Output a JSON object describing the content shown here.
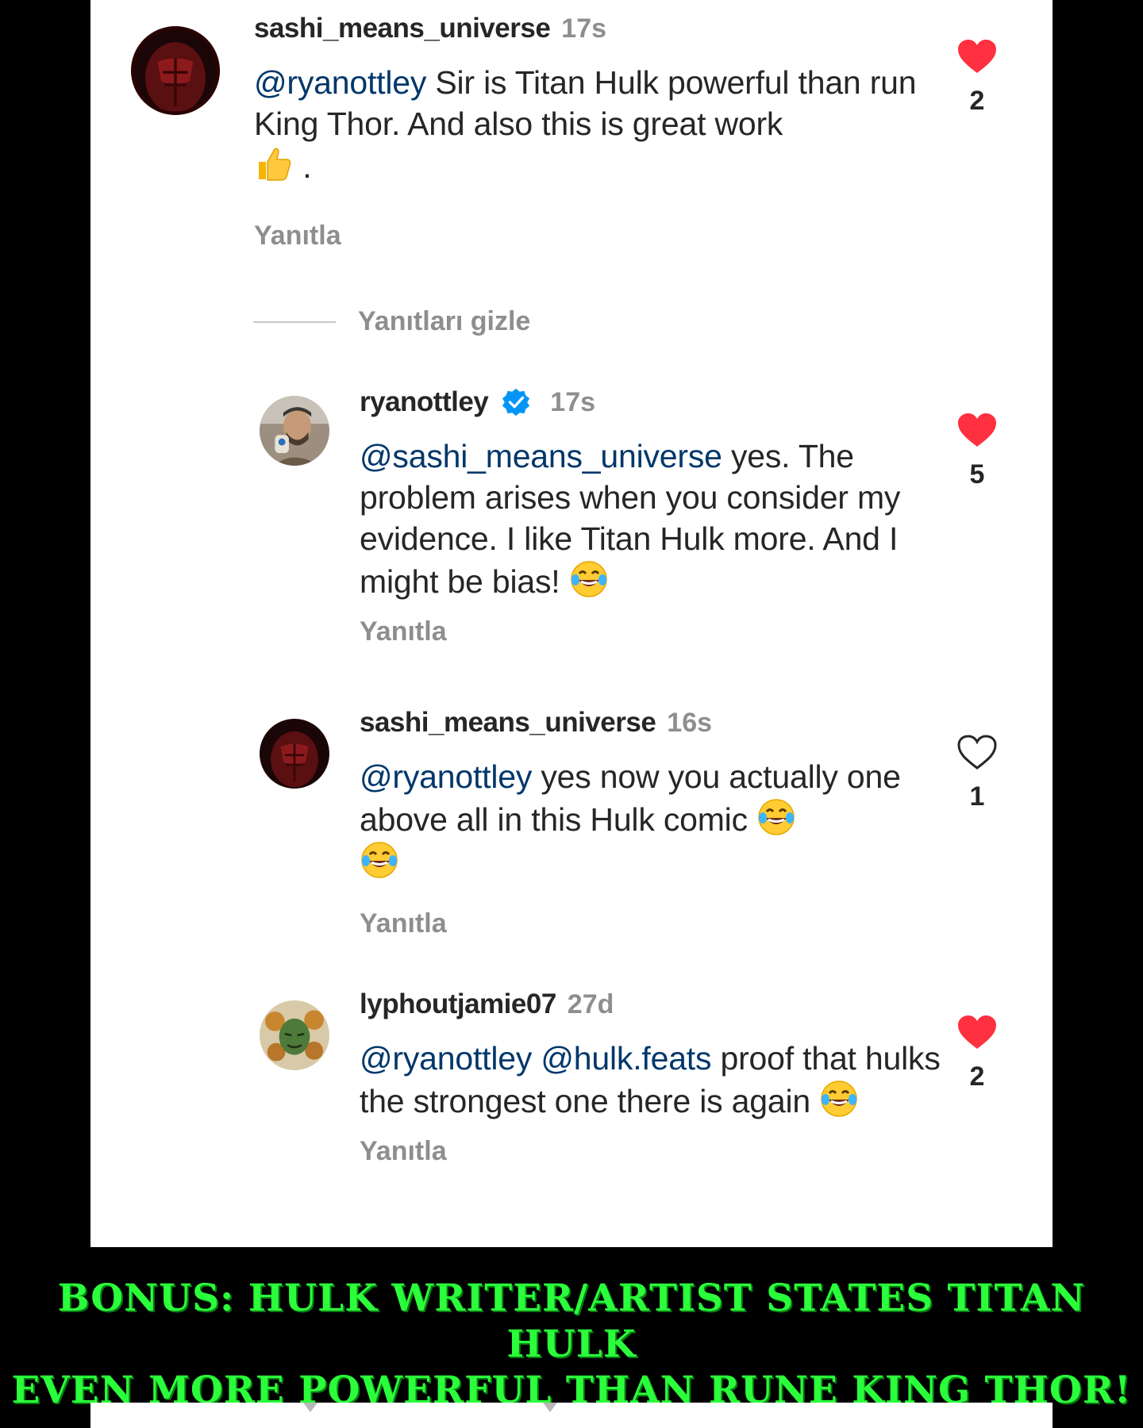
{
  "comments": [
    {
      "username": "sashi_means_universe",
      "time": "17s",
      "mention": "@ryanottley",
      "text": " Sir is Titan Hulk powerful than run King Thor. And also this is great work",
      "trailing": " .",
      "emoji": "thumbs-up",
      "reply_label": "Yanıtla",
      "likes": "2",
      "liked": true
    },
    {
      "username": "ryanottley",
      "verified": true,
      "time": "17s",
      "mention": "@sashi_means_universe",
      "text": " yes. The problem arises when you consider my evidence. I like Titan Hulk more. And I might be bias!",
      "emoji": "laughing-tears",
      "reply_label": "Yanıtla",
      "likes": "5",
      "liked": true
    },
    {
      "username": "sashi_means_universe",
      "time": "16s",
      "mention": "@ryanottley",
      "text": " yes now you actually one above all in this Hulk comic",
      "emoji": "laughing-tears",
      "reply_label": "Yanıtla",
      "likes": "1",
      "liked": false
    },
    {
      "username": "lyphoutjamie07",
      "time": "27d",
      "mention": "@ryanottley",
      "mention2": "@hulk.feats",
      "text": " proof that hulks the strongest one there is again",
      "emoji": "laughing-tears",
      "reply_label": "Yanıtla",
      "likes": "2",
      "liked": true
    }
  ],
  "hide_replies_label": "Yanıtları gizle",
  "caption": {
    "line1": "BONUS: HULK WRITER/ARTIST STATES TITAN HULK",
    "line2": "EVEN MORE POWERFUL THAN RUNE KING THOR!"
  },
  "colors": {
    "like_red": "#ff3040",
    "mention_blue": "#00376b",
    "caption_green": "#2bff3b",
    "verified_blue": "#0095f6"
  }
}
